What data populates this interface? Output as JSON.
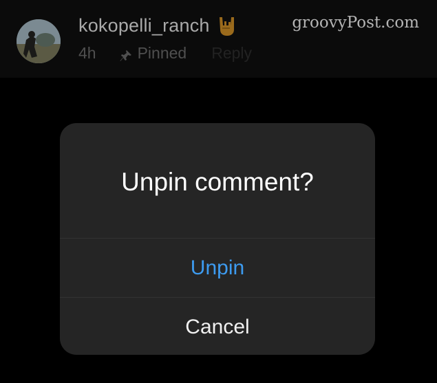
{
  "comment": {
    "username": "kokopelli_ranch",
    "emoji_icon": "sign-of-horns-emoji",
    "time": "4h",
    "pin_icon": "pin-icon",
    "pinned_label": "Pinned",
    "reply_label": "Reply"
  },
  "watermark": "groovyPost.com",
  "dialog": {
    "title": "Unpin comment?",
    "unpin_label": "Unpin",
    "cancel_label": "Cancel"
  },
  "colors": {
    "background": "#000000",
    "dialog_bg": "#252525",
    "accent": "#3d9bf0"
  }
}
